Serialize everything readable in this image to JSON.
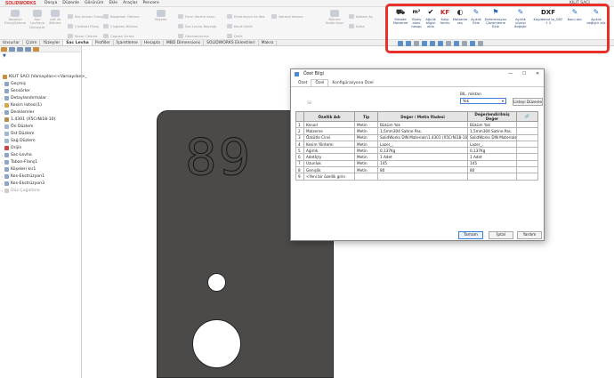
{
  "app": {
    "logo": "SOLIDWORKS",
    "window_title": "KILIT SACI"
  },
  "menu": [
    "Dosya",
    "Düzenle",
    "Görünüm",
    "Ekle",
    "Araçlar",
    "Pencere"
  ],
  "ribbon": {
    "large": [
      {
        "label": "Tabakalı\nFlanş/Sekme"
      },
      {
        "label": "Sac\nLevhaya\nDönüştür"
      },
      {
        "label": "Loft ile\nBükme"
      },
      {
        "label": "Ekstrüzyon\nile Kes"
      },
      {
        "label": "Köşeler"
      },
      {
        "label": "Bükme\nKaldırılıyor"
      },
      {
        "label": "Katla"
      }
    ],
    "small": [
      {
        "label": "Sac Kenarı Flanşı"
      },
      {
        "label": "Çizimsel Flanş"
      },
      {
        "label": "Kenar Çekme"
      },
      {
        "label": "Basamak Ötelme"
      },
      {
        "label": "Çizgiden Bükme"
      },
      {
        "label": "Çaprazı Kırma"
      },
      {
        "label": "Form Verme Aracı"
      },
      {
        "label": "Sac Levha Bayrağı"
      },
      {
        "label": "Havalandırma"
      },
      {
        "label": "Ekstrüzyon ile Kes"
      },
      {
        "label": "Kesik Delik"
      },
      {
        "label": "Delik"
      },
      {
        "label": "Normal Kesme"
      },
      {
        "label": "Katlanı Aç"
      },
      {
        "label": "Katla"
      }
    ]
  },
  "custom_toolbar": [
    {
      "icon": "⛟",
      "label": "Mesafe\nMalzeme"
    },
    {
      "icon": "m²",
      "label": "Yüzey\nalanı\nhesap"
    },
    {
      "icon": "✔",
      "label": "Ağırlık\nbilgisi\nekle"
    },
    {
      "icon": "KF",
      "label": "Kalıp\nformu"
    },
    {
      "icon": "◐",
      "label": "Malzeme\nseç"
    },
    {
      "icon": "✎",
      "label": "Açıklık\nEkle"
    },
    {
      "icon": "⚑",
      "label": "Deformasyon\nÇözümleme\nEkle"
    },
    {
      "icon": "✎",
      "label": "Açıklık\nyüzeyi\ndeğiştir"
    },
    {
      "icon": "DXF",
      "label": "Kaydetme to_DXF\n+ 2"
    },
    {
      "icon": "✎",
      "label": "Konu alıc"
    },
    {
      "icon": "✎",
      "label": "Açıklık\ndeğiştir alıc"
    }
  ],
  "tabs": [
    "Unsurlar",
    "Çizim",
    "Yüzeyler",
    "Sac Levha",
    "Profiller",
    "İşaretleme",
    "Hesapla",
    "MBD Dimensions",
    "SOLIDWORKS Eklentileri",
    "Makro"
  ],
  "active_tab": "Sac Levha",
  "tree": [
    {
      "label": "KILIT SACI  (Varsayılan<<Varsayılan>_"
    },
    {
      "label": "Geçmiş"
    },
    {
      "label": "Sensörler"
    },
    {
      "label": "Detaylandırmalar"
    },
    {
      "label": "Kesim listesi(1)"
    },
    {
      "label": "Denklemler"
    },
    {
      "label": "1.4301 (X5CrNi18-10)"
    },
    {
      "label": "Ön Düzlem"
    },
    {
      "label": "Üst Düzlem"
    },
    {
      "label": "Sağ Düzlem"
    },
    {
      "label": "Orijin"
    },
    {
      "label": "Sac-Levha"
    },
    {
      "label": "Taban-Flanş1"
    },
    {
      "label": "Köşeleri kır1"
    },
    {
      "label": "Kes-Ekstrüzyon1"
    },
    {
      "label": "Kes-Ekstrüzyon3"
    },
    {
      "label": "Düz-Çoğaltma"
    }
  ],
  "part": {
    "engraving": "89"
  },
  "dialog": {
    "title": "Özet Bilgi",
    "tabs": [
      "Özet",
      "Özel",
      "Konfigürasyona Özel"
    ],
    "active_tab": "Özel",
    "delete_label": "Sil",
    "bom_label": "BIL. miktarı",
    "bom_value": "Yok",
    "edit_list_label": "Listeyi Düzenle",
    "columns": [
      "",
      "Özellik Adı",
      "Tip",
      "Değer / Metin İfadesi",
      "Değerlendirilmiş Değer",
      ""
    ],
    "rows": [
      {
        "n": "1",
        "name": "Kenarl",
        "type": "Metin",
        "value": "Büküm Yok",
        "eval": "Büküm Yok"
      },
      {
        "n": "2",
        "name": "Malzeme",
        "type": "Metin",
        "value": "1,5mm304 Satine Pas.",
        "eval": "1,5mm304 Satine Pas."
      },
      {
        "n": "3",
        "name": "Özkütle Cinsi",
        "type": "Metin",
        "value": "SolidWorks DIN Materials\\1.4301 (X5CrNi18-10)\\1",
        "eval": "SolidWorks DIN Materials"
      },
      {
        "n": "4",
        "name": "Kesim Yöntemi",
        "type": "Metin",
        "value": "Lazer_,",
        "eval": "Lazer_,"
      },
      {
        "n": "5",
        "name": "Ağırlık",
        "type": "Metin",
        "value": "0,137Kg",
        "eval": "0,137Kg"
      },
      {
        "n": "6",
        "name": "Adetİçty",
        "type": "Metin",
        "value": "1 Adet",
        "eval": "1 Adet"
      },
      {
        "n": "7",
        "name": "Uzunluk",
        "type": "Metin",
        "value": "145",
        "eval": "145"
      },
      {
        "n": "8",
        "name": "Genişlik",
        "type": "Metin",
        "value": "80",
        "eval": "80"
      },
      {
        "n": "9",
        "name": "<Yeni bir özellik girin",
        "type": "",
        "value": "",
        "eval": ""
      }
    ],
    "ok": "Tamam",
    "cancel": "İptal",
    "help": "Yardım"
  }
}
